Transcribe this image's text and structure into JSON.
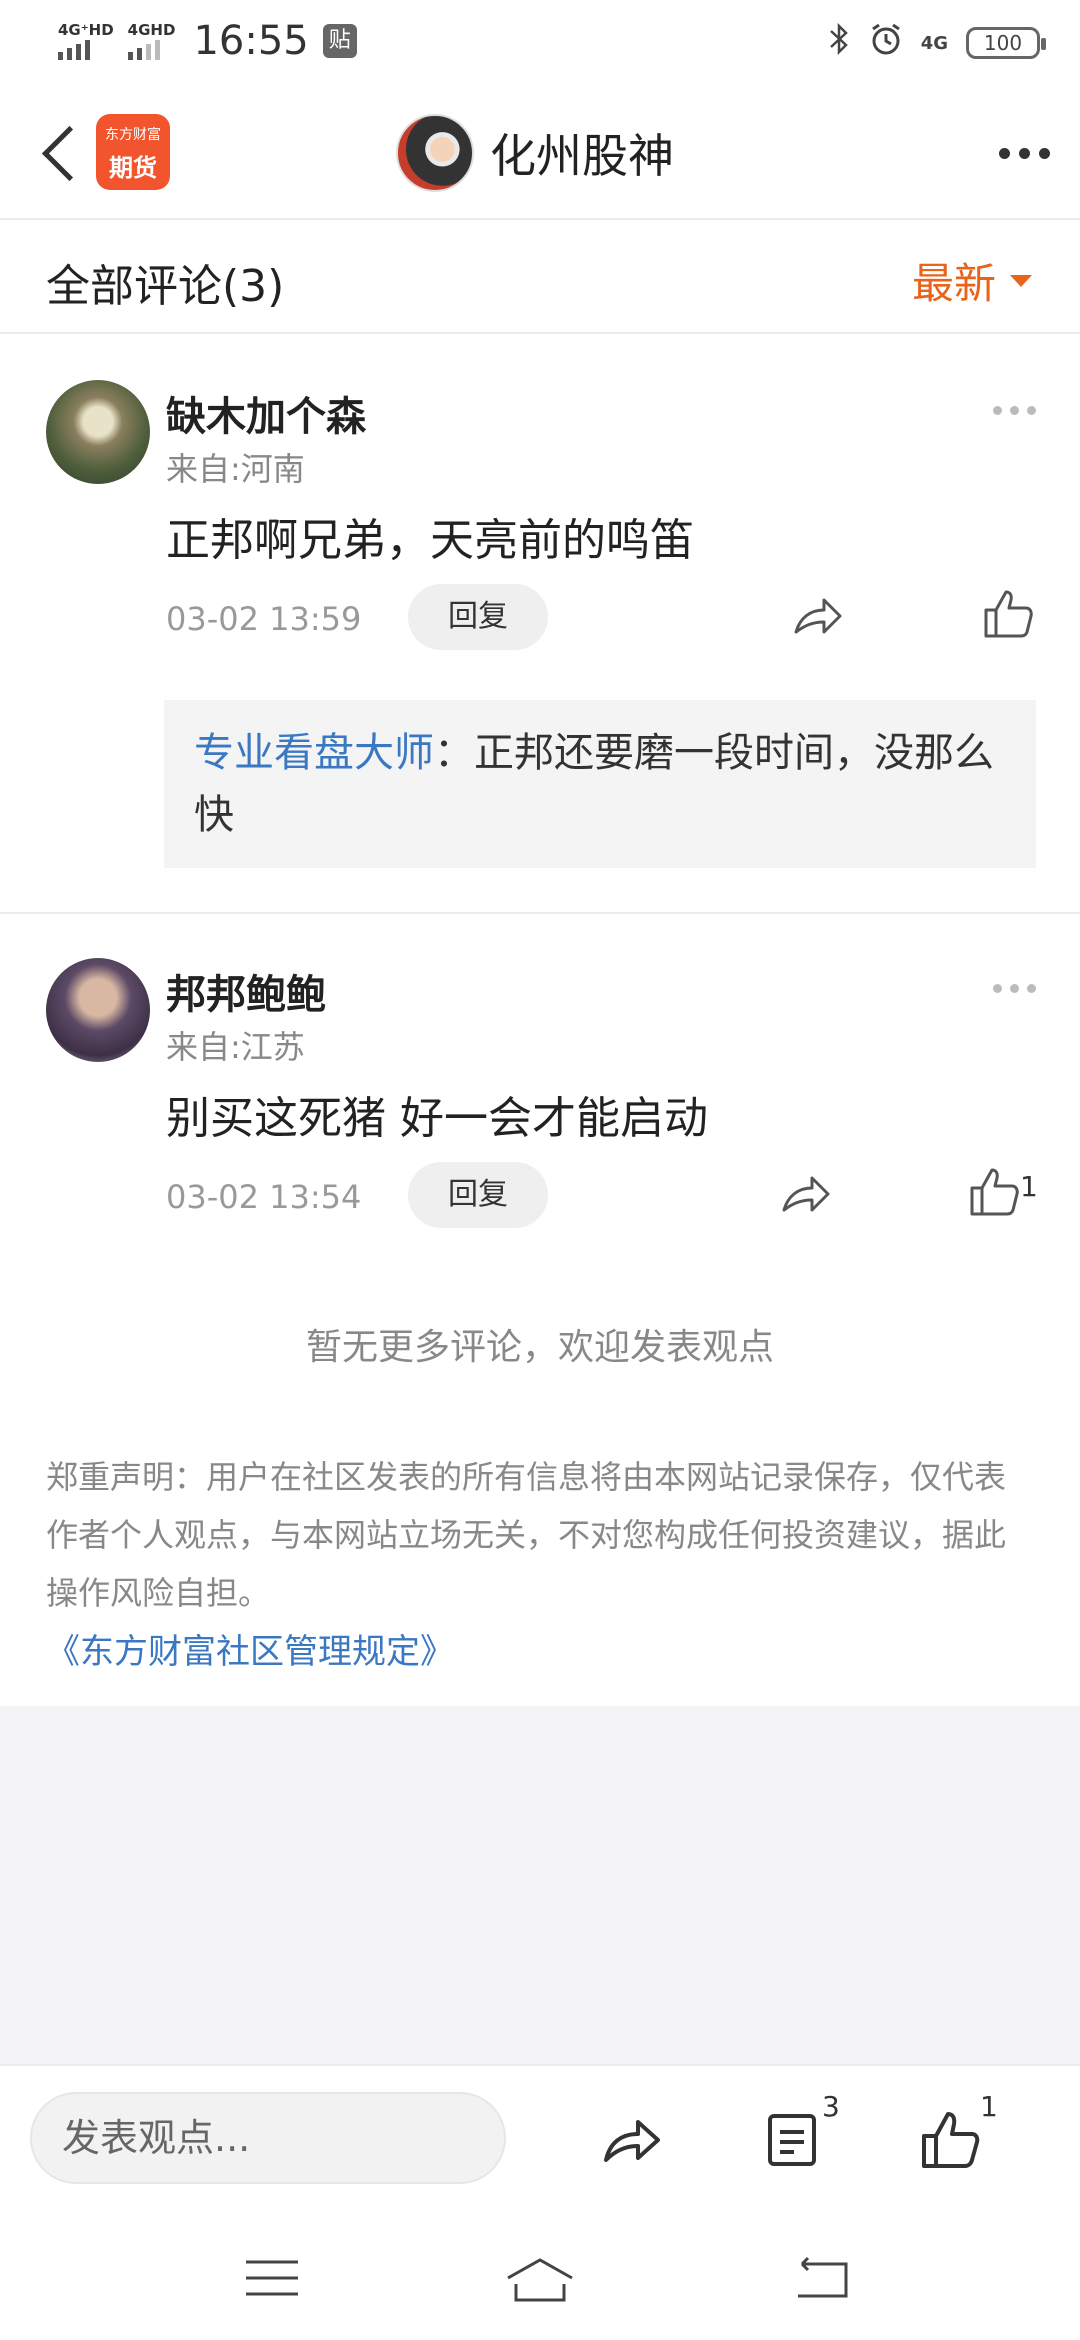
{
  "status_bar": {
    "sim1": "4G⁺HD",
    "sim2": "4GHD",
    "time": "16:55",
    "notif": "贴",
    "net": "4G",
    "battery": "100"
  },
  "nav": {
    "app_logo_top": "东方财富",
    "app_logo_text": "期货",
    "title": "化州股神"
  },
  "comments_header": {
    "count_label": "全部评论(3)",
    "sort_label": "最新"
  },
  "comments": [
    {
      "user": "缺木加个森",
      "location": "来自:河南",
      "text": "正邦啊兄弟，天亮前的鸣笛",
      "time": "03-02 13:59",
      "reply_label": "回复",
      "likes": "",
      "sub_reply": {
        "user": "专业看盘大师",
        "text": "：正邦还要磨一段时间，没那么快"
      }
    },
    {
      "user": "邦邦鲍鲍",
      "location": "来自:江苏",
      "text": "别买这死猪 好一会才能启动",
      "time": "03-02 13:54",
      "reply_label": "回复",
      "likes": "1"
    }
  ],
  "no_more": "暂无更多评论，欢迎发表观点",
  "disclaimer": "郑重声明：用户在社区发表的所有信息将由本网站记录保存，仅代表作者个人观点，与本网站立场无关，不对您构成任何投资建议，据此操作风险自担。",
  "rules_link": "《东方财富社区管理规定》",
  "bottom_bar": {
    "input_placeholder": "发表观点...",
    "comment_count": "3",
    "like_count": "1"
  }
}
